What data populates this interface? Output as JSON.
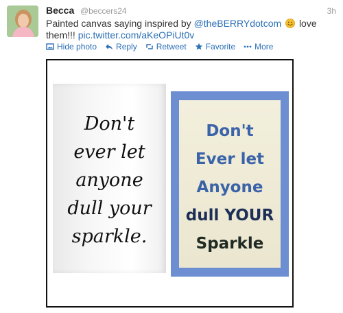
{
  "tweet": {
    "name": "Becca",
    "handle": "@beccers24",
    "time": "3h",
    "text_prefix": "Painted canvas saying inspired by",
    "mention": "@theBERRYdotcom",
    "text_suffix": "love",
    "text_line2": "them!!!",
    "pic_link": "pic.twitter.com/aKeOPiUt0v",
    "emoji": "smiley-icon"
  },
  "actions": {
    "hide_photo": "Hide photo",
    "reply": "Reply",
    "retweet": "Retweet",
    "favorite": "Favorite",
    "more": "More"
  },
  "photo": {
    "left_canvas": [
      "Don't",
      "ever let",
      "anyone",
      "dull your",
      "sparkle."
    ],
    "right_canvas": [
      "Don't",
      "Ever let",
      "Anyone",
      "dull YOUR",
      "Sparkle"
    ]
  },
  "colors": {
    "link": "#2a6fb6",
    "right_canvas_border": "#6d8fd2",
    "right_canvas_text": "#3b63a8"
  }
}
